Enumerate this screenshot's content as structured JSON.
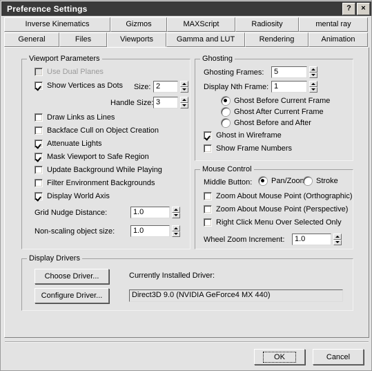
{
  "window": {
    "title": "Preference Settings",
    "help_button": "?",
    "close_button": "×"
  },
  "tabs": {
    "row1": [
      {
        "label": "Inverse Kinematics",
        "width": 154,
        "active": false
      },
      {
        "label": "Gizmos",
        "width": 82,
        "active": false
      },
      {
        "label": "MAXScript",
        "width": 99,
        "active": false
      },
      {
        "label": "Radiosity",
        "width": 92,
        "active": false
      },
      {
        "label": "mental ray",
        "width": 100,
        "active": false
      }
    ],
    "row2": [
      {
        "label": "General",
        "width": 80,
        "active": false
      },
      {
        "label": "Files",
        "width": 69,
        "active": false
      },
      {
        "label": "Viewports",
        "width": 86,
        "active": true
      },
      {
        "label": "Gamma and LUT",
        "width": 114,
        "active": false
      },
      {
        "label": "Rendering",
        "width": 92,
        "active": false
      },
      {
        "label": "Animation",
        "width": 86,
        "active": false
      }
    ]
  },
  "viewport_parameters": {
    "title": "Viewport Parameters",
    "use_dual_planes": {
      "label": "Use Dual Planes",
      "checked": false,
      "disabled": true
    },
    "show_vertices_as_dots": {
      "label": "Show Vertices as Dots",
      "checked": true,
      "disabled": false
    },
    "size": {
      "label": "Size:",
      "value": "2"
    },
    "handle_size": {
      "label": "Handle Size:",
      "value": "3"
    },
    "draw_links_as_lines": {
      "label": "Draw Links as Lines",
      "checked": false,
      "disabled": false
    },
    "backface_cull": {
      "label": "Backface Cull on Object Creation",
      "checked": false,
      "disabled": false
    },
    "attenuate_lights": {
      "label": "Attenuate Lights",
      "checked": true,
      "disabled": false
    },
    "mask_viewport": {
      "label": "Mask Viewport to Safe Region",
      "checked": true,
      "disabled": false
    },
    "update_background": {
      "label": "Update Background While Playing",
      "checked": false,
      "disabled": false
    },
    "filter_environment": {
      "label": "Filter Environment Backgrounds",
      "checked": false,
      "disabled": false
    },
    "display_world_axis": {
      "label": "Display World Axis",
      "checked": true,
      "disabled": false
    },
    "grid_nudge_distance": {
      "label": "Grid Nudge Distance:",
      "value": "1.0"
    },
    "non_scaling_object_size": {
      "label": "Non-scaling object size:",
      "value": "1.0"
    }
  },
  "ghosting": {
    "title": "Ghosting",
    "ghosting_frames": {
      "label": "Ghosting Frames:",
      "value": "5"
    },
    "display_nth_frame": {
      "label": "Display Nth Frame:",
      "value": "1"
    },
    "radio_options": [
      {
        "label": "Ghost Before Current Frame",
        "checked": true
      },
      {
        "label": "Ghost After Current Frame",
        "checked": false
      },
      {
        "label": "Ghost Before and After",
        "checked": false
      }
    ],
    "ghost_in_wireframe": {
      "label": "Ghost in Wireframe",
      "checked": true
    },
    "show_frame_numbers": {
      "label": "Show Frame Numbers",
      "checked": false
    }
  },
  "mouse_control": {
    "title": "Mouse Control",
    "middle_button_label": "Middle Button:",
    "middle_button_options": [
      {
        "label": "Pan/Zoom",
        "checked": true
      },
      {
        "label": "Stroke",
        "checked": false
      }
    ],
    "zoom_about_mouse_orthographic": {
      "label": "Zoom About Mouse Point (Orthographic)",
      "checked": false
    },
    "zoom_about_mouse_perspective": {
      "label": "Zoom About Mouse Point (Perspective)",
      "checked": false
    },
    "right_click_menu": {
      "label": "Right Click Menu Over Selected Only",
      "checked": false
    },
    "wheel_zoom_increment": {
      "label": "Wheel Zoom Increment:",
      "value": "1.0"
    }
  },
  "display_drivers": {
    "title": "Display Drivers",
    "choose_driver": "Choose Driver...",
    "configure_driver": "Configure Driver...",
    "currently_installed_label": "Currently Installed Driver:",
    "driver_name": "Direct3D 9.0 (NVIDIA GeForce4 MX 440)"
  },
  "footer": {
    "ok": "OK",
    "cancel": "Cancel"
  },
  "colors": {
    "dialog_background": "#e3e3e3",
    "titlebar": "#3a3a3a",
    "field_background": "#ffffff",
    "disabled_text": "#9a9a9a"
  }
}
